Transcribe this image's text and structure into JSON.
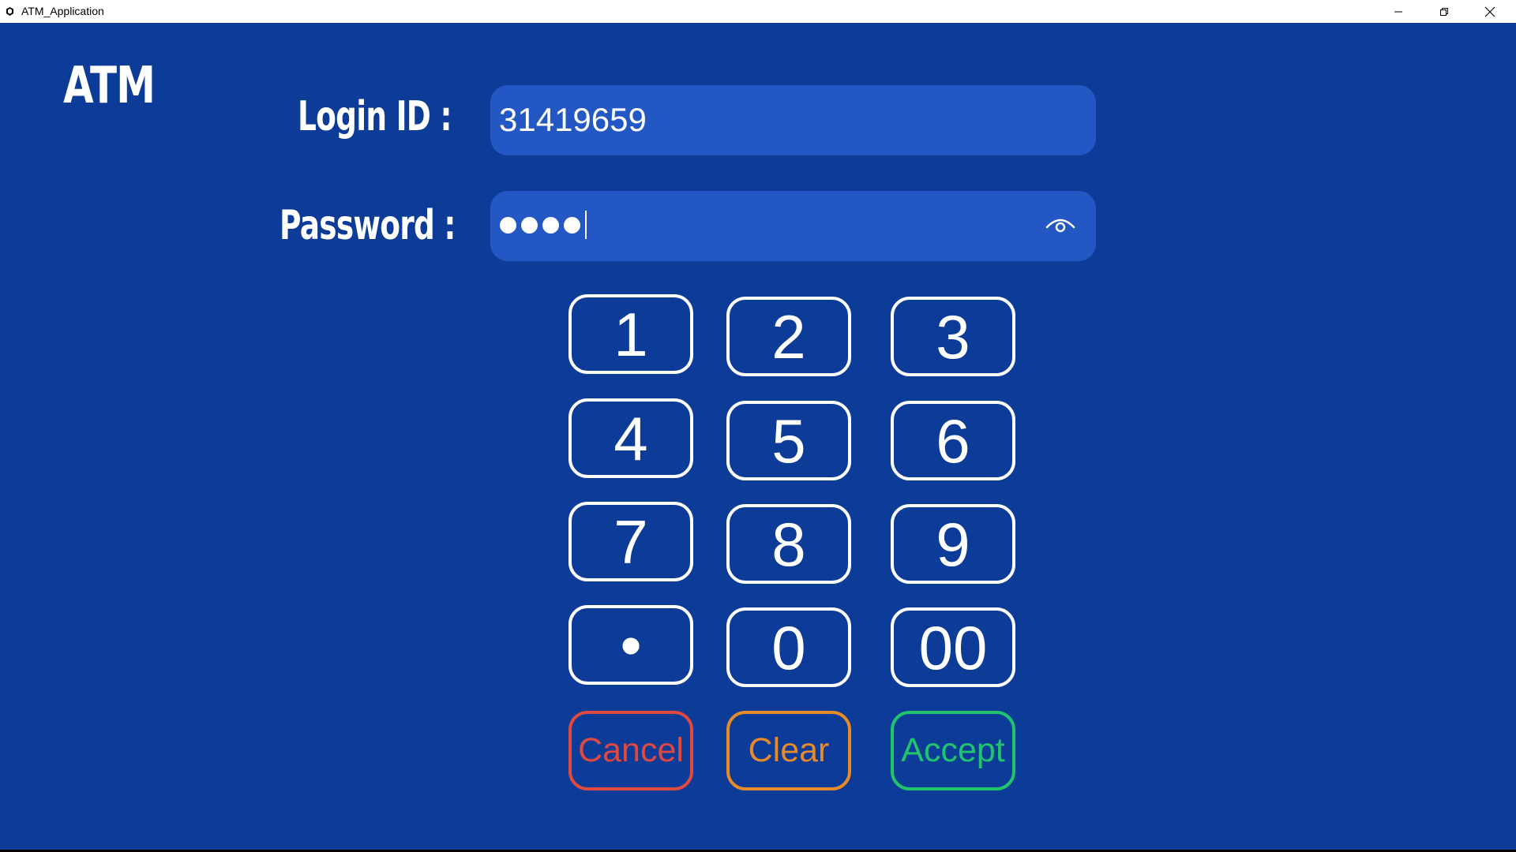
{
  "window": {
    "title": "ATM_Application",
    "background": "#0c3b98"
  },
  "logo": "ATM",
  "login": {
    "label": "Login ID :",
    "value": "31419659"
  },
  "password": {
    "label": "Password :",
    "masked_length": 4,
    "toggle_icon": "eye-icon"
  },
  "keypad": {
    "rows": [
      [
        "1",
        "2",
        "3"
      ],
      [
        "4",
        "5",
        "6"
      ],
      [
        "7",
        "8",
        "9"
      ],
      [
        "•",
        "0",
        "00"
      ]
    ]
  },
  "actions": {
    "cancel": {
      "label": "Cancel",
      "color": "#e0493f"
    },
    "clear": {
      "label": "Clear",
      "color": "#e68a2a"
    },
    "accept": {
      "label": "Accept",
      "color": "#1fc46c"
    }
  }
}
